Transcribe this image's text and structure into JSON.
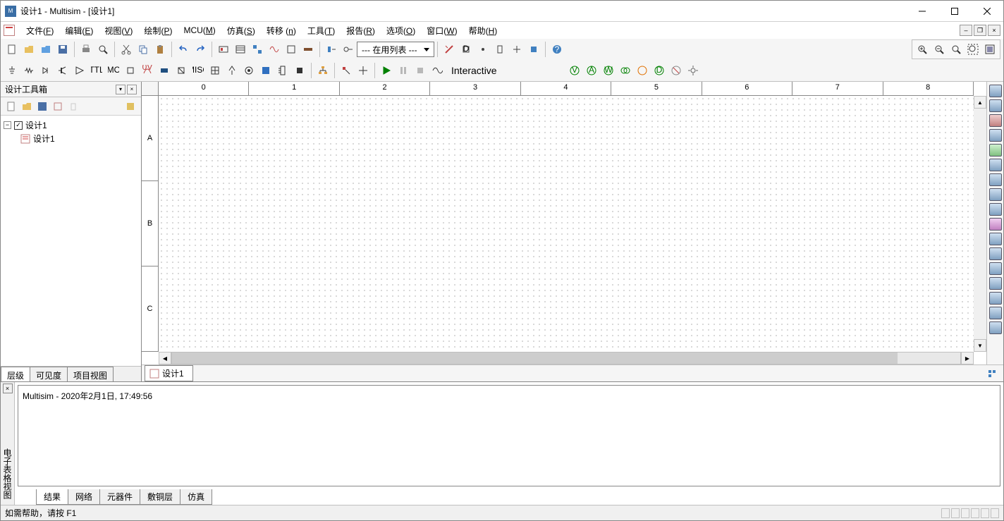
{
  "window": {
    "title": "设计1 - Multisim - [设计1]"
  },
  "menu": {
    "file": {
      "label": "文件",
      "hotkey": "F"
    },
    "edit": {
      "label": "编辑",
      "hotkey": "E"
    },
    "view": {
      "label": "视图",
      "hotkey": "V"
    },
    "draw": {
      "label": "绘制",
      "hotkey": "P"
    },
    "mcu": {
      "label": "MCU",
      "hotkey": "M"
    },
    "sim": {
      "label": "仿真",
      "hotkey": "S"
    },
    "transfer": {
      "label": "转移",
      "hotkey": "n"
    },
    "tools": {
      "label": "工具",
      "hotkey": "T"
    },
    "report": {
      "label": "报告",
      "hotkey": "R"
    },
    "options": {
      "label": "选项",
      "hotkey": "O"
    },
    "window": {
      "label": "窗口",
      "hotkey": "W"
    },
    "help": {
      "label": "帮助",
      "hotkey": "H"
    }
  },
  "toolbar": {
    "combo_active_list": "--- 在用列表 ---",
    "sim_mode_prefix": "",
    "sim_mode": "Interactive"
  },
  "left_panel": {
    "title": "设计工具箱",
    "root": "设计1",
    "child": "设计1",
    "tabs": [
      "层级",
      "可见度",
      "项目视图"
    ],
    "active_tab_index": 0
  },
  "canvas": {
    "ruler_h": [
      "0",
      "1",
      "2",
      "3",
      "4",
      "5",
      "6",
      "7",
      "8"
    ],
    "ruler_v": [
      "A",
      "B",
      "C"
    ],
    "tab": "设计1"
  },
  "bottom": {
    "vertical_label": "电子表格视图",
    "log_line": "Multisim  -  2020年2月1日, 17:49:56",
    "tabs": [
      "结果",
      "网络",
      "元器件",
      "敷铜层",
      "仿真"
    ],
    "active_tab_index": 0
  },
  "status": {
    "help_text": "如需帮助，请按 F1"
  }
}
